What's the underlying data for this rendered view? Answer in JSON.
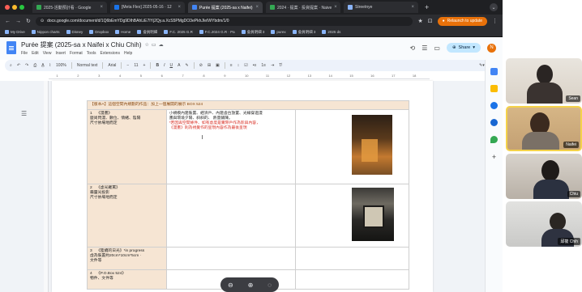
{
  "browser": {
    "tabs": [
      {
        "label": "2025-活動預計看 · Google",
        "fav_color": "#34a853",
        "active": false
      },
      {
        "label": "[Meta Flex] 2025-05-16 · 12",
        "fav_color": "#1a73e8",
        "active": false
      },
      {
        "label": "Purée 提案 (2025-sa x Naifei)",
        "fav_color": "#4285f4",
        "active": true
      },
      {
        "label": "2024 · 提案 · 投資提案 · Naive",
        "fav_color": "#34a853",
        "active": false
      },
      {
        "label": "Streetnye",
        "fav_color": "#8ab4f8",
        "active": false
      }
    ],
    "new_tab": "+",
    "url": "docs.google.com/document/d/1Q6bEmYDg9DIhBAhLiE7IYj2Qy.a.XcS5PMgDO3ePkhJIeIWYbdm/1/0",
    "update_button": "Relaunch to update",
    "bookmarks": [
      "My Drive",
      "Nippon charts",
      "Disney",
      "Dropbox",
      "Home",
      "會員明細",
      "F.C. 2025 G.R",
      "F.C.2024 G.R · Pa",
      "會員明細 3",
      "purex",
      "會員明細 3",
      "2025 ds"
    ]
  },
  "docs": {
    "title": "Purée 提案 (2025-sa x Naifei x Chiu Chih)",
    "menu": [
      "File",
      "Edit",
      "View",
      "Insert",
      "Format",
      "Tools",
      "Extensions",
      "Help"
    ],
    "share_label": "Share",
    "user_initial": "N",
    "toolbar": {
      "zoom": "100%",
      "style": "Normal text",
      "font": "Arial",
      "font_size": "11"
    },
    "ruler_marks": [
      "1",
      "2",
      "3",
      "4",
      "5",
      "6",
      "7",
      "8",
      "9",
      "10",
      "11",
      "12",
      "13",
      "14",
      "15",
      "16",
      "17",
      "18"
    ]
  },
  "table": {
    "header": "【版本A】這個空間內規劃的作品：加上一個展開的展示 BOX 524",
    "rows": [
      {
        "num": "1",
        "left": [
          "《漫畫》",
          "麼尚閃漫、數位、情緒、陰陽",
          "尺寸依場地而定"
        ],
        "middle": [
          "小規模內建裝置、經濟戶、內建虛台放置、光線穿過漫",
          "畫與環境夕陽、斜斜的、 熱量鋪陳。"
        ],
        "middle_red": [
          "*若因與空間條件、如有虛度是實際戶作為影與內容，",
          "《漫畫》則為視覺作的呈現內容作為最後呈現"
        ],
        "has_photo": true,
        "photo": "photo1"
      },
      {
        "num": "2",
        "left": [
          "《虛光羅罵》",
          "霧靈光投影",
          "尺寸依場地而定"
        ],
        "middle": [],
        "middle_red": [],
        "has_photo": true,
        "photo": "photo2"
      },
      {
        "num": "3",
        "left": [
          "《陸續的日光》*in progress",
          "虛為裝置約20cm*10cm*5cm ·",
          "文件等"
        ],
        "middle": [],
        "middle_red": [],
        "has_photo": false
      },
      {
        "num": "4",
        "left": [
          "《P.O.Box 524》",
          "物件、文件等"
        ],
        "middle": [],
        "middle_red": [],
        "has_photo": false
      }
    ]
  },
  "participants": [
    {
      "name": "Sean"
    },
    {
      "name": "Naifei"
    },
    {
      "name": "Chiu"
    },
    {
      "name": "邱筱 Chih"
    }
  ],
  "colors": {
    "tab_bg": "#1f2023",
    "docs_blue": "#4285f4",
    "share_bg": "#c2e7ff",
    "header_cell": "#f6e5d3",
    "red_text": "#d93025",
    "update_orange": "#e8710a"
  }
}
